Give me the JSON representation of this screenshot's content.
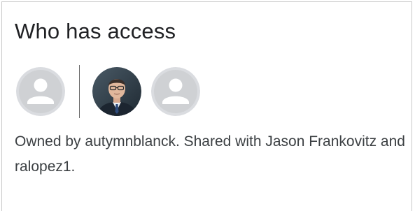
{
  "panel": {
    "title": "Who has access",
    "avatars": [
      {
        "icon": "default-user-icon",
        "kind": "owner"
      },
      {
        "icon": "user-photo",
        "kind": "shared"
      },
      {
        "icon": "default-user-icon",
        "kind": "shared"
      }
    ],
    "description": "Owned by autymnblanck. Shared with Jason Frankovitz and ralopez1."
  },
  "colors": {
    "avatar_bg": "#dadce0",
    "avatar_glyph": "#ffffff",
    "photo_bg": "#2b3a44"
  }
}
